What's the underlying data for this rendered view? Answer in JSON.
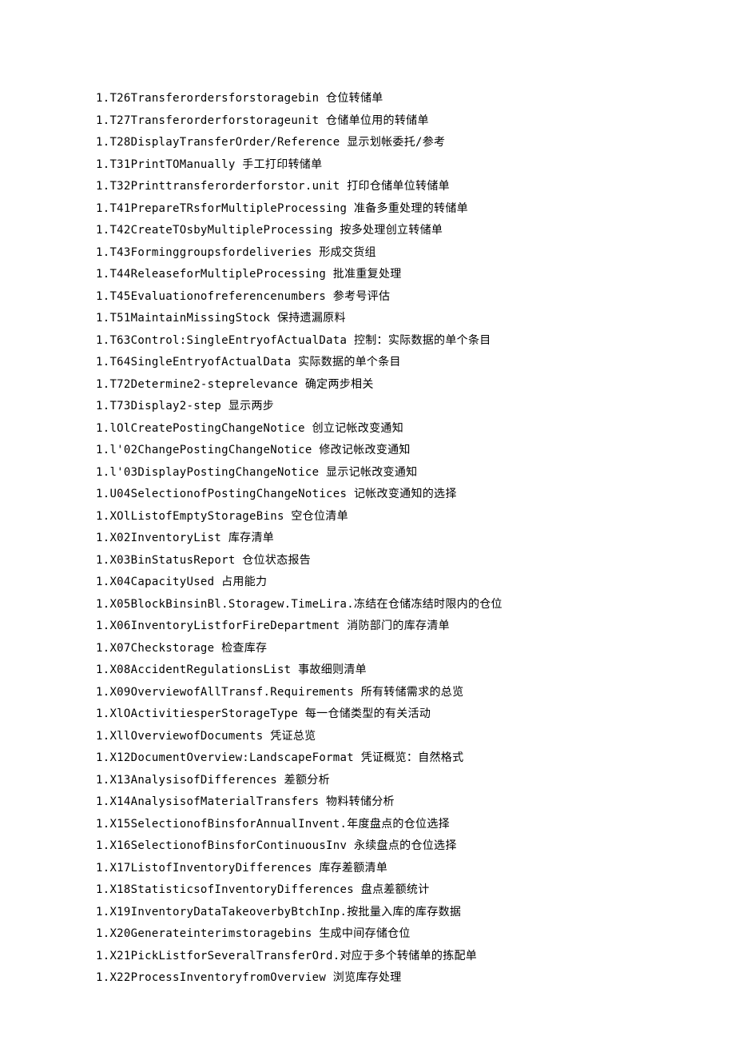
{
  "lines": [
    "1.T26Transferordersforstoragebin 仓位转储单",
    "1.T27Transferorderforstorageunit 仓储单位用的转储单",
    "1.T28DisplayTransferOrder/Reference 显示划帐委托/参考",
    "1.T31PrintTOManually 手工打印转储单",
    "1.T32Printtransferorderforstor.unit 打印仓储单位转储单",
    "1.T41PrepareTRsforMultipleProcessing 准备多重处理的转储单",
    "1.T42CreateTOsbyMultipleProcessing 按多处理创立转储单",
    "1.T43Forminggroupsfordeliveries 形成交货组",
    "1.T44ReleaseforMultipleProcessing 批准重复处理",
    "1.T45Evaluationofreferencenumbers 参考号评估",
    "1.T51MaintainMissingStock 保持遗漏原料",
    "1.T63Control:SingleEntryofActualData 控制：实际数据的单个条目",
    "1.T64SingleEntryofActualData 实际数据的单个条目",
    "1.T72Determine2-steprelevance 确定两步相关",
    "1.T73Display2-step 显示两步",
    "1.lOlCreatePostingChangeNotice 创立记帐改变通知",
    "1.l'02ChangePostingChangeNotice 修改记帐改变通知",
    "1.l'03DisplayPostingChangeNotice 显示记帐改变通知",
    "1.U04SelectionofPostingChangeNotices 记帐改变通知的选择",
    "1.XOlListofEmptyStorageBins 空仓位清单",
    "1.X02InventoryList 库存清单",
    "1.X03BinStatusReport 仓位状态报告",
    "1.X04CapacityUsed 占用能力",
    "1.X05BlockBinsinBl.Storagew.TimeLira.冻结在仓储冻结时限内的仓位",
    "1.X06InventoryListforFireDepartment 消防部门的库存清单",
    "1.X07Checkstorage 检查库存",
    "1.X08AccidentRegulationsList 事故细则清单",
    "1.X09OverviewofAllTransf.Requirements 所有转储需求的总览",
    "1.XlOActivitiesperStorageType 每一仓储类型的有关活动",
    "1.XllOverviewofDocuments 凭证总览",
    "1.X12DocumentOverview:LandscapeFormat 凭证概览：自然格式",
    "1.X13AnalysisofDifferences 差额分析",
    "1.X14AnalysisofMaterialTransfers 物料转储分析",
    "1.X15SelectionofBinsforAnnualInvent.年度盘点的仓位选择",
    "1.X16SelectionofBinsforContinuousInv 永续盘点的仓位选择",
    "1.X17ListofInventoryDifferences 库存差额清单",
    "1.X18StatisticsofInventoryDifferences 盘点差额统计",
    "1.X19InventoryDataTakeoverbyBtchInp.按批量入库的库存数据",
    "1.X20Generateinterimstoragebins 生成中间存储仓位",
    "1.X21PickListforSeveralTransferOrd.对应于多个转储单的拣配单",
    "1.X22ProcessInventoryfromOverview 浏览库存处理"
  ]
}
